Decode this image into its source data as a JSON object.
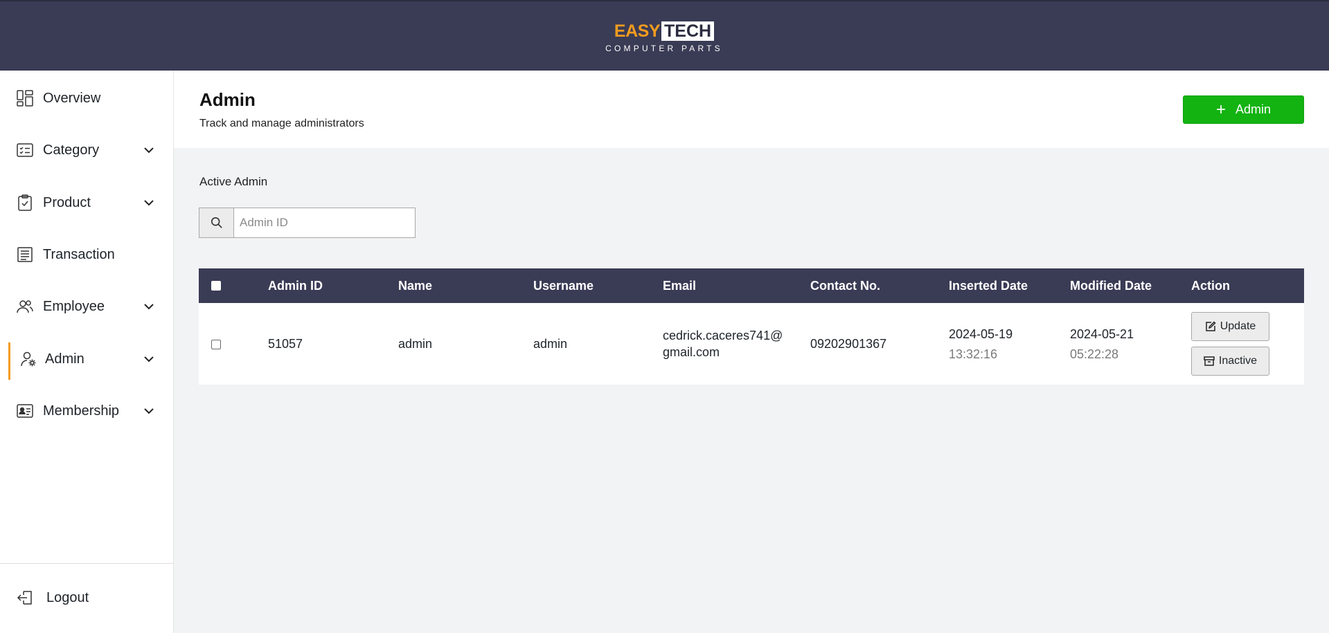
{
  "brand": {
    "easy": "EASY",
    "tech": "TECH",
    "tagline": "COMPUTER PARTS",
    "accent": "#f39c1f",
    "header_bg": "#3a3b55"
  },
  "sidebar": {
    "items": [
      {
        "label": "Overview",
        "icon": "dashboard-icon",
        "has_chevron": false,
        "active": false
      },
      {
        "label": "Category",
        "icon": "list-card-icon",
        "has_chevron": true,
        "active": false
      },
      {
        "label": "Product",
        "icon": "clipboard-check-icon",
        "has_chevron": true,
        "active": false
      },
      {
        "label": "Transaction",
        "icon": "receipt-icon",
        "has_chevron": false,
        "active": false
      },
      {
        "label": "Employee",
        "icon": "users-icon",
        "has_chevron": true,
        "active": false
      },
      {
        "label": "Admin",
        "icon": "user-gear-icon",
        "has_chevron": true,
        "active": true
      },
      {
        "label": "Membership",
        "icon": "id-card-icon",
        "has_chevron": true,
        "active": false
      }
    ],
    "logout_label": "Logout"
  },
  "header": {
    "title": "Admin",
    "subtitle": "Track and manage administrators",
    "add_button_label": "Admin",
    "add_button_color": "#13b312"
  },
  "content": {
    "section_label": "Active Admin",
    "search": {
      "placeholder": "Admin ID",
      "value": ""
    }
  },
  "table": {
    "columns": [
      "Admin ID",
      "Name",
      "Username",
      "Email",
      "Contact No.",
      "Inserted Date",
      "Modified Date",
      "Action"
    ],
    "rows": [
      {
        "admin_id": "51057",
        "name": "admin",
        "username": "admin",
        "email_line1": "cedrick.caceres741@",
        "email_line2": "gmail.com",
        "contact": "09202901367",
        "inserted_date": "2024-05-19",
        "inserted_time": "13:32:16",
        "modified_date": "2024-05-21",
        "modified_time": "05:22:28",
        "update_label": "Update",
        "inactive_label": "Inactive"
      }
    ]
  }
}
